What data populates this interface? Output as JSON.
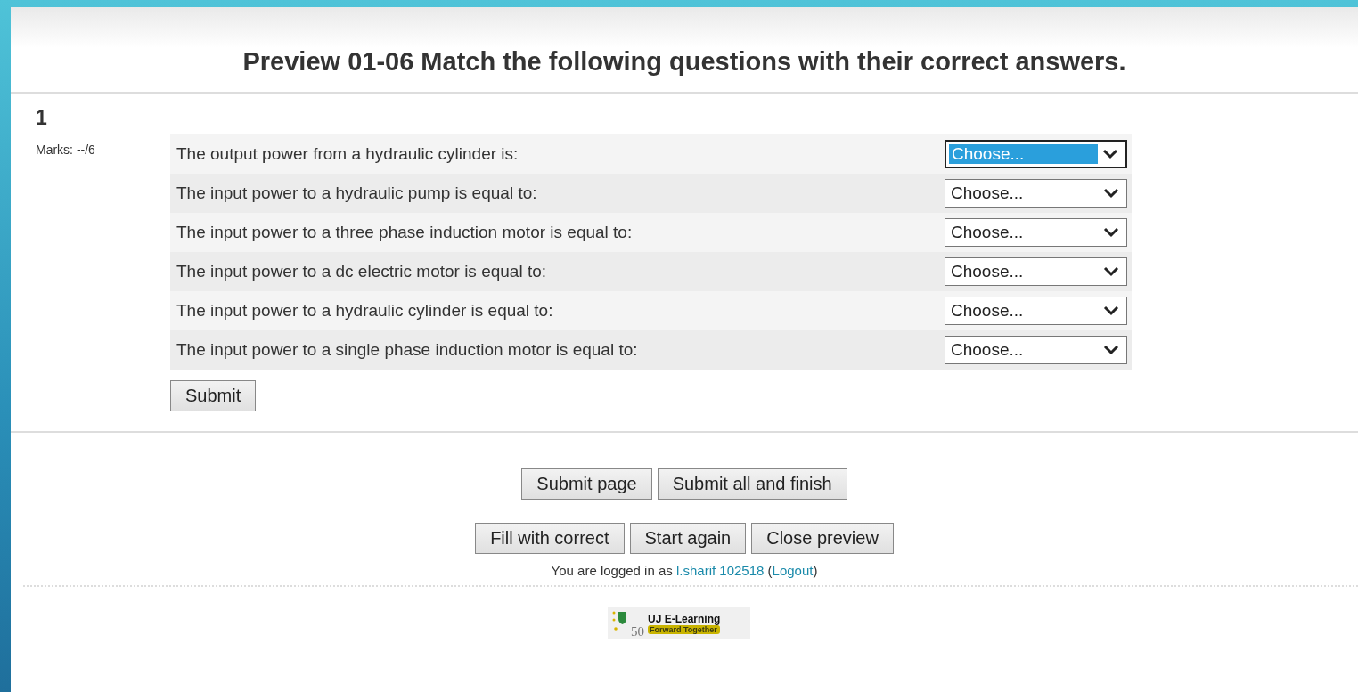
{
  "title": "Preview 01-06 Match the following questions with their correct answers.",
  "question": {
    "number": "1",
    "marks": "Marks: --/6",
    "rows": [
      {
        "text": "The output power from a hydraulic cylinder is:",
        "choice": "Choose...",
        "focused": true
      },
      {
        "text": "The input power to a hydraulic pump is equal to:",
        "choice": "Choose...",
        "focused": false
      },
      {
        "text": "The input power to a three phase induction motor is equal to:",
        "choice": "Choose...",
        "focused": false
      },
      {
        "text": "The input power to a dc electric motor is equal to:",
        "choice": "Choose...",
        "focused": false
      },
      {
        "text": "The input power to a hydraulic cylinder is equal to:",
        "choice": "Choose...",
        "focused": false
      },
      {
        "text": "The input power to a single phase induction motor is equal to:",
        "choice": "Choose...",
        "focused": false
      }
    ],
    "submit": "Submit"
  },
  "navigation": {
    "buttons": [
      "Submit page",
      "Submit all and finish"
    ]
  },
  "preview_controls": {
    "buttons": [
      "Fill with correct",
      "Start again",
      "Close preview"
    ]
  },
  "login_info": {
    "prefix": "You are logged in as",
    "user": "l.sharif 102518",
    "open": "(",
    "logout": "Logout",
    "close": ")"
  },
  "logo": {
    "title": "UJ E-Learning",
    "slogan": "Forward Together",
    "number": "50"
  }
}
